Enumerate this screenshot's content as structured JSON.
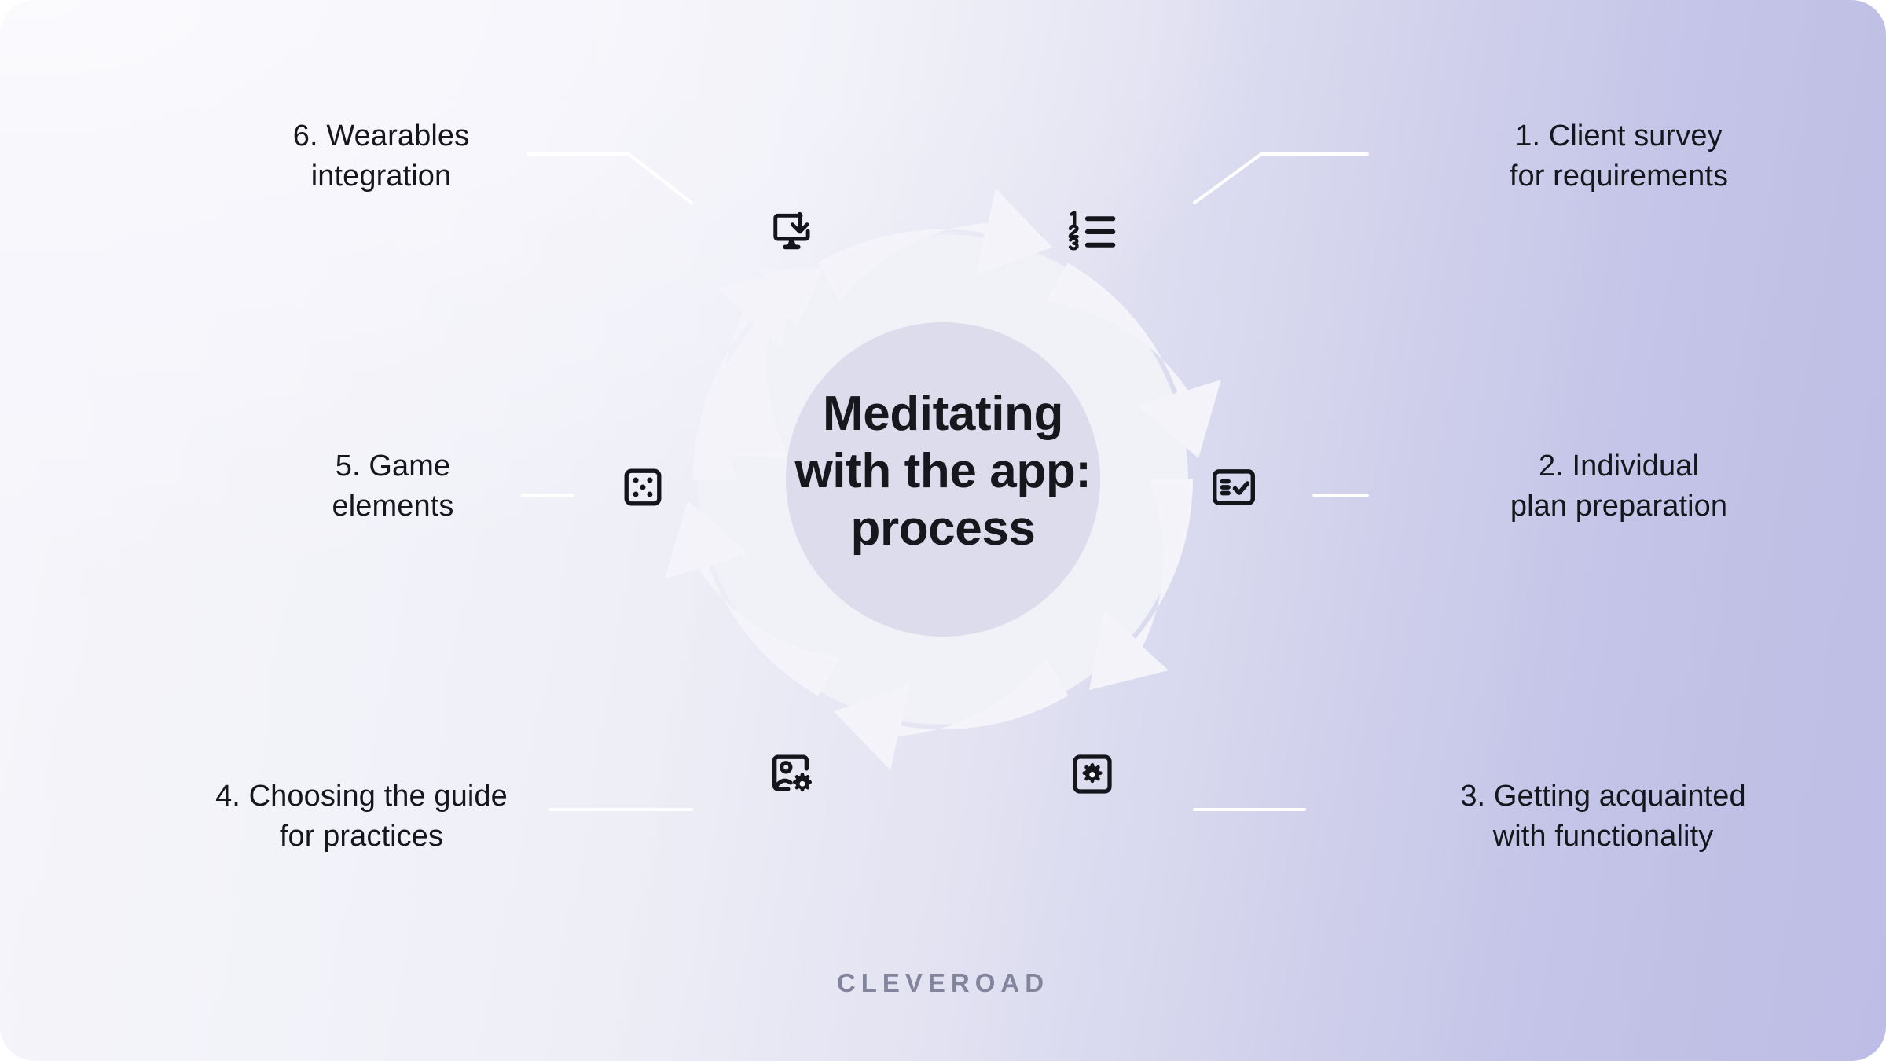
{
  "card": {
    "background_left_color": "#f7f7fc",
    "background_right_color": "#bcbce6",
    "corner_radius_px": 44
  },
  "center": {
    "title": "Meditating\nwith the app:\nprocess",
    "disc_color": "#f2f2f8",
    "inner_disc_color": "#dcdcec"
  },
  "wheel": {
    "segment_color": "#f3f3f9",
    "segment_count": 6,
    "direction": "clockwise"
  },
  "connector_color": "#ffffff",
  "steps": [
    {
      "number": "1",
      "label": "1. Client survey\nfor requirements",
      "icon": "numbered-list-icon",
      "side": "right",
      "position": "top-right"
    },
    {
      "number": "2",
      "label": "2. Individual\nplan preparation",
      "icon": "checklist-icon",
      "side": "right",
      "position": "middle-right"
    },
    {
      "number": "3",
      "label": "3. Getting acquainted\nwith functionality",
      "icon": "gear-square-icon",
      "side": "right",
      "position": "bottom-right"
    },
    {
      "number": "4",
      "label": "4. Choosing the guide\nfor practices",
      "icon": "image-settings-icon",
      "side": "left",
      "position": "bottom-left"
    },
    {
      "number": "5",
      "label": "5. Game\nelements",
      "icon": "dice-icon",
      "side": "left",
      "position": "middle-left"
    },
    {
      "number": "6",
      "label": "6. Wearables\nintegration",
      "icon": "monitor-download-icon",
      "side": "left",
      "position": "top-left"
    }
  ],
  "footer": {
    "brand": "CLEVEROAD",
    "brand_color": "#80839b"
  }
}
